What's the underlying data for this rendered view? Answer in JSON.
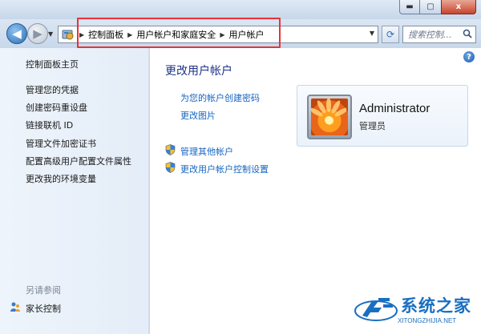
{
  "window": {
    "controls": [
      "minimize",
      "maximize",
      "close"
    ],
    "close_glyph": "x"
  },
  "navigation": {
    "breadcrumb": [
      "控制面板",
      "用户帐户和家庭安全",
      "用户帐户"
    ],
    "search_placeholder": "搜索控制...",
    "highlight_color": "#e8333a"
  },
  "sidebar": {
    "home_link": "控制面板主页",
    "links": [
      "管理您的凭据",
      "创建密码重设盘",
      "链接联机 ID",
      "管理文件加密证书",
      "配置高级用户配置文件属性",
      "更改我的环境变量"
    ],
    "see_also_heading": "另请参阅",
    "see_also_links": [
      "家长控制"
    ]
  },
  "main": {
    "title": "更改用户帐户",
    "tasks": [
      "为您的帐户创建密码",
      "更改图片"
    ],
    "shield_tasks": [
      "管理其他帐户",
      "更改用户帐户控制设置"
    ],
    "help_glyph": "?"
  },
  "user": {
    "name": "Administrator",
    "role": "管理员"
  },
  "watermark": {
    "name": "系统之家",
    "url": "XITONGZHIJIA.NET"
  },
  "colors": {
    "link": "#1565c0",
    "title": "#1e3287",
    "sidebar_bg": "#e9f1fa"
  }
}
